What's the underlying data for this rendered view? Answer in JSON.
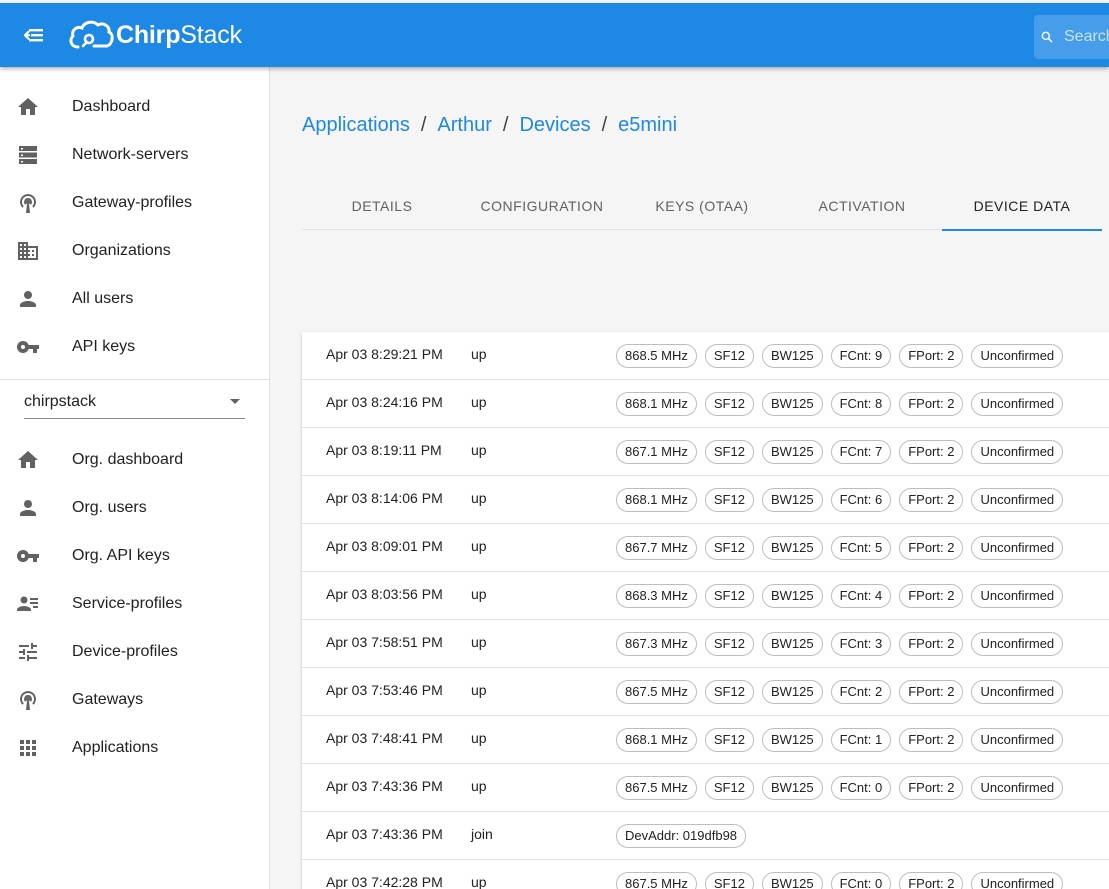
{
  "app": {
    "title_prefix": "Chirp",
    "title_suffix": "Stack"
  },
  "search": {
    "placeholder": "Search"
  },
  "sidebar": {
    "global_items": [
      {
        "label": "Dashboard",
        "icon": "home-icon"
      },
      {
        "label": "Network-servers",
        "icon": "server-icon"
      },
      {
        "label": "Gateway-profiles",
        "icon": "antenna-icon"
      },
      {
        "label": "Organizations",
        "icon": "building-icon"
      },
      {
        "label": "All users",
        "icon": "person-icon"
      },
      {
        "label": "API keys",
        "icon": "key-icon"
      }
    ],
    "org_select": {
      "value": "chirpstack"
    },
    "org_items": [
      {
        "label": "Org. dashboard",
        "icon": "home-icon"
      },
      {
        "label": "Org. users",
        "icon": "person-icon"
      },
      {
        "label": "Org. API keys",
        "icon": "key-icon"
      },
      {
        "label": "Service-profiles",
        "icon": "account-details-icon"
      },
      {
        "label": "Device-profiles",
        "icon": "tune-icon"
      },
      {
        "label": "Gateways",
        "icon": "antenna-icon"
      },
      {
        "label": "Applications",
        "icon": "apps-grid-icon"
      }
    ]
  },
  "breadcrumb": {
    "items": [
      "Applications",
      "Arthur",
      "Devices",
      "e5mini"
    ],
    "separator": "/"
  },
  "tabs": [
    {
      "label": "DETAILS",
      "active": false
    },
    {
      "label": "CONFIGURATION",
      "active": false
    },
    {
      "label": "KEYS (OTAA)",
      "active": false
    },
    {
      "label": "ACTIVATION",
      "active": false
    },
    {
      "label": "DEVICE DATA",
      "active": true
    }
  ],
  "device_data": {
    "rows": [
      {
        "time": "Apr 03 8:29:21 PM",
        "type": "up",
        "chips": [
          "868.5 MHz",
          "SF12",
          "BW125",
          "FCnt: 9",
          "FPort: 2",
          "Unconfirmed"
        ]
      },
      {
        "time": "Apr 03 8:24:16 PM",
        "type": "up",
        "chips": [
          "868.1 MHz",
          "SF12",
          "BW125",
          "FCnt: 8",
          "FPort: 2",
          "Unconfirmed"
        ]
      },
      {
        "time": "Apr 03 8:19:11 PM",
        "type": "up",
        "chips": [
          "867.1 MHz",
          "SF12",
          "BW125",
          "FCnt: 7",
          "FPort: 2",
          "Unconfirmed"
        ]
      },
      {
        "time": "Apr 03 8:14:06 PM",
        "type": "up",
        "chips": [
          "868.1 MHz",
          "SF12",
          "BW125",
          "FCnt: 6",
          "FPort: 2",
          "Unconfirmed"
        ]
      },
      {
        "time": "Apr 03 8:09:01 PM",
        "type": "up",
        "chips": [
          "867.7 MHz",
          "SF12",
          "BW125",
          "FCnt: 5",
          "FPort: 2",
          "Unconfirmed"
        ]
      },
      {
        "time": "Apr 03 8:03:56 PM",
        "type": "up",
        "chips": [
          "868.3 MHz",
          "SF12",
          "BW125",
          "FCnt: 4",
          "FPort: 2",
          "Unconfirmed"
        ]
      },
      {
        "time": "Apr 03 7:58:51 PM",
        "type": "up",
        "chips": [
          "867.3 MHz",
          "SF12",
          "BW125",
          "FCnt: 3",
          "FPort: 2",
          "Unconfirmed"
        ]
      },
      {
        "time": "Apr 03 7:53:46 PM",
        "type": "up",
        "chips": [
          "867.5 MHz",
          "SF12",
          "BW125",
          "FCnt: 2",
          "FPort: 2",
          "Unconfirmed"
        ]
      },
      {
        "time": "Apr 03 7:48:41 PM",
        "type": "up",
        "chips": [
          "868.1 MHz",
          "SF12",
          "BW125",
          "FCnt: 1",
          "FPort: 2",
          "Unconfirmed"
        ]
      },
      {
        "time": "Apr 03 7:43:36 PM",
        "type": "up",
        "chips": [
          "867.5 MHz",
          "SF12",
          "BW125",
          "FCnt: 0",
          "FPort: 2",
          "Unconfirmed"
        ]
      },
      {
        "time": "Apr 03 7:43:36 PM",
        "type": "join",
        "chips": [
          "DevAddr: 019dfb98"
        ]
      },
      {
        "time": "Apr 03 7:42:28 PM",
        "type": "up",
        "chips": [
          "867.5 MHz",
          "SF12",
          "BW125",
          "FCnt: 0",
          "FPort: 2",
          "Unconfirmed"
        ]
      }
    ]
  },
  "colors": {
    "primary": "#1e88e5",
    "icon": "#616161",
    "divider": "#e0e0e0",
    "chip_border": "#bdbdbd"
  }
}
